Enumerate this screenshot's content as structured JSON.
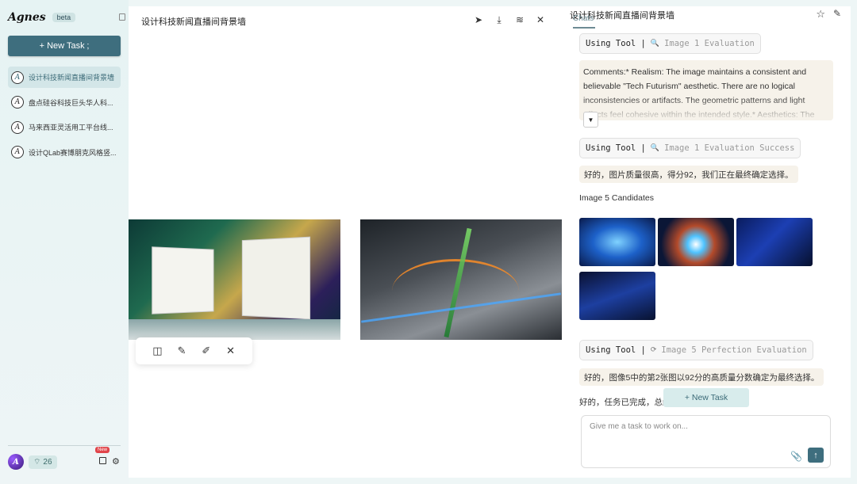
{
  "app": {
    "name": "Agnes",
    "badge": "beta"
  },
  "sidebar": {
    "new_task_label": "+ New Task ;",
    "tasks": [
      {
        "label": "设计科技新闻直播间背景墙",
        "active": true
      },
      {
        "label": "盘点硅谷科技巨头华人科...",
        "active": false
      },
      {
        "label": "马来西亚灵活用工平台线...",
        "active": false
      },
      {
        "label": "设计QLab赛博朋克风格竖...",
        "active": false
      }
    ],
    "credits": "26",
    "new_badge": "New"
  },
  "canvas": {
    "title": "设计科技新闻直播间背景墙",
    "tools": [
      "pointer-icon",
      "download-icon",
      "layers-icon",
      "close-icon"
    ],
    "float_tools": [
      "split-icon",
      "brush-icon",
      "edit-icon",
      "close-icon"
    ]
  },
  "chat": {
    "header_title": "设计科技新闻直播间背景墙",
    "tab": "Chats",
    "tool_call_1": {
      "prefix": "Using Tool |",
      "name": "Image 1 Evaluation"
    },
    "comment_text": "Comments:* Realism: The image maintains a consistent and believable \"Tech Futurism\" aesthetic. There are no logical inconsistencies or artifacts. The geometric patterns and light effects feel cohesive within the intended style.* Aesthetics: The",
    "tool_call_2": {
      "prefix": "Using Tool |",
      "name": "Image 1 Evaluation Success"
    },
    "msg_1": "好的，图片质量很高，得分92，我们正在最终确定选择。",
    "candidates_label": "Image 5 Candidates",
    "tool_call_3": {
      "prefix": "Using Tool |",
      "name": "Image 5 Perfection Evaluation"
    },
    "msg_2": "好的，图像5中的第2张图以92分的高质量分数确定为最终选择。",
    "final_text": "好的，任务已完成，总结",
    "new_task_chip": "+ New Task",
    "input_placeholder": "Give me a task to work on..."
  },
  "colors": {
    "accent": "#3e6e7e",
    "active_bg": "#d3e6e8",
    "chip_bg": "#f6f2ea"
  }
}
